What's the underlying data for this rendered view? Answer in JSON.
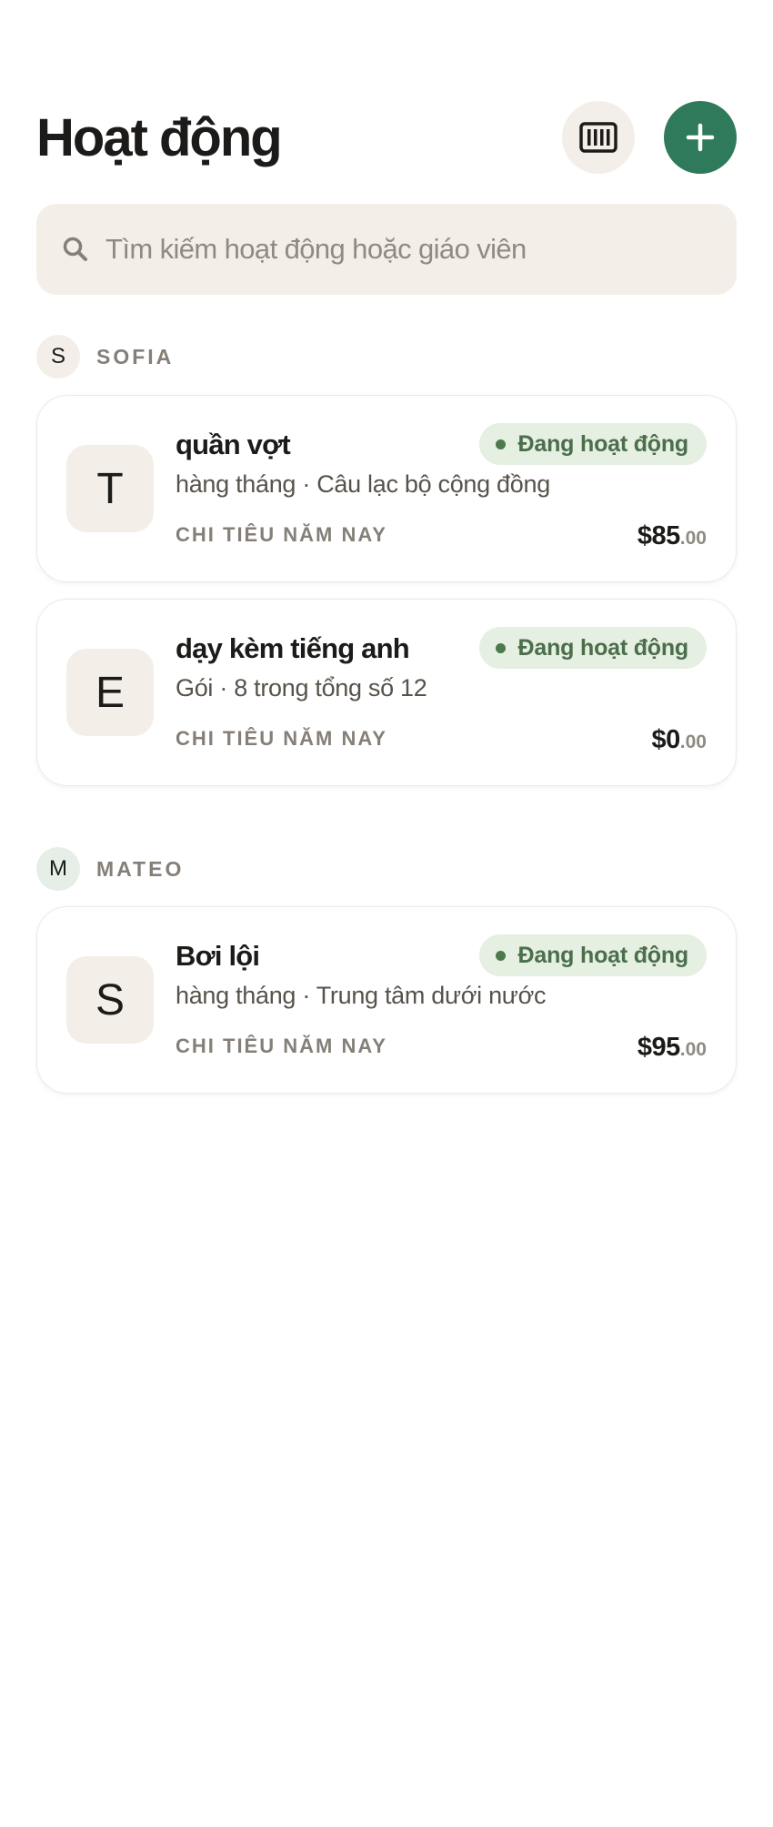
{
  "header": {
    "title": "Hoạt động",
    "barcode_icon": "barcode-icon",
    "add_icon": "plus-icon"
  },
  "search": {
    "placeholder": "Tìm kiếm hoạt động hoặc giáo viên",
    "icon": "search-icon"
  },
  "colors": {
    "accent": "#2e7a5a",
    "surface": "#f3efe8",
    "status_bg": "#e5efe2",
    "status_text": "#4b6e4b"
  },
  "groups": [
    {
      "initial": "S",
      "name": "SOFIA",
      "activities": [
        {
          "initial": "T",
          "title": "quần vợt",
          "subtitle": "hàng tháng · Câu lạc bộ cộng đồng",
          "status": "Đang hoạt động",
          "label": "CHI TIÊU NĂM NAY",
          "amount_main": "$85",
          "amount_cents": ".00"
        },
        {
          "initial": "E",
          "title": "dạy kèm tiếng anh",
          "subtitle": "Gói · 8 trong tổng số 12",
          "status": "Đang hoạt động",
          "label": "CHI TIÊU NĂM NAY",
          "amount_main": "$0",
          "amount_cents": ".00"
        }
      ]
    },
    {
      "initial": "M",
      "name": "MATEO",
      "activities": [
        {
          "initial": "S",
          "title": "Bơi lội",
          "subtitle": "hàng tháng · Trung tâm dưới nước",
          "status": "Đang hoạt động",
          "label": "CHI TIÊU NĂM NAY",
          "amount_main": "$95",
          "amount_cents": ".00"
        }
      ]
    }
  ]
}
